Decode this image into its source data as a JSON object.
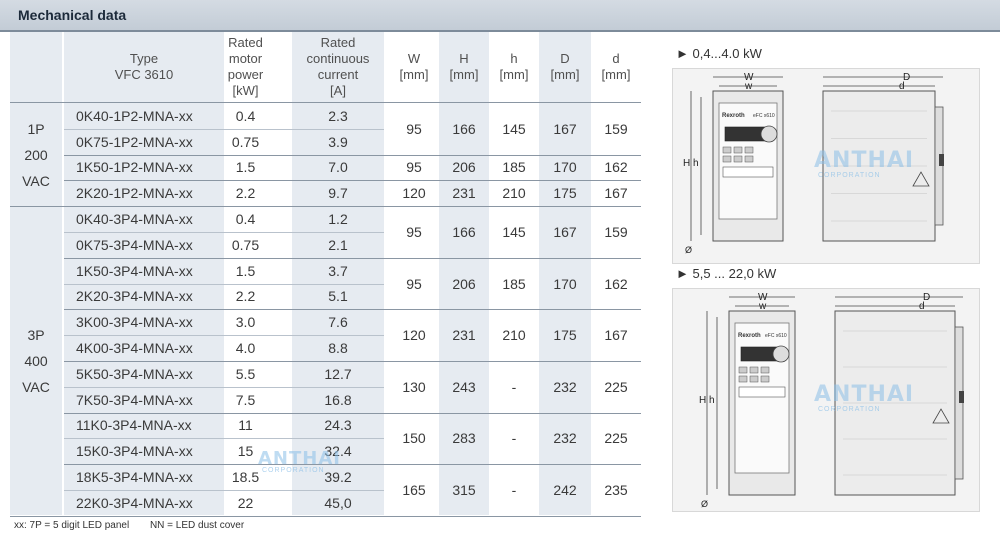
{
  "section_title": "Mechanical data",
  "headers": {
    "type": [
      "Type",
      "VFC 3610"
    ],
    "power": [
      "Rated",
      "motor",
      "power",
      "[kW]"
    ],
    "current": [
      "Rated",
      "continuous",
      "current",
      "[A]"
    ],
    "W": [
      "W",
      "[mm]"
    ],
    "H": [
      "H",
      "[mm]"
    ],
    "h": [
      "h",
      "[mm]"
    ],
    "D": [
      "D",
      "[mm]"
    ],
    "d": [
      "d",
      "[mm]"
    ]
  },
  "groups": [
    {
      "label": [
        "1P",
        "200",
        "VAC"
      ]
    },
    {
      "label": [
        "3P",
        "400",
        "VAC"
      ]
    }
  ],
  "rows": [
    {
      "type": "0K40-1P2-MNA-xx",
      "kw": "0.4",
      "a": "2.3"
    },
    {
      "type": "0K75-1P2-MNA-xx",
      "kw": "0.75",
      "a": "3.9"
    },
    {
      "type": "1K50-1P2-MNA-xx",
      "kw": "1.5",
      "a": "7.0"
    },
    {
      "type": "2K20-1P2-MNA-xx",
      "kw": "2.2",
      "a": "9.7"
    },
    {
      "type": "0K40-3P4-MNA-xx",
      "kw": "0.4",
      "a": "1.2"
    },
    {
      "type": "0K75-3P4-MNA-xx",
      "kw": "0.75",
      "a": "2.1"
    },
    {
      "type": "1K50-3P4-MNA-xx",
      "kw": "1.5",
      "a": "3.7"
    },
    {
      "type": "2K20-3P4-MNA-xx",
      "kw": "2.2",
      "a": "5.1"
    },
    {
      "type": "3K00-3P4-MNA-xx",
      "kw": "3.0",
      "a": "7.6"
    },
    {
      "type": "4K00-3P4-MNA-xx",
      "kw": "4.0",
      "a": "8.8"
    },
    {
      "type": "5K50-3P4-MNA-xx",
      "kw": "5.5",
      "a": "12.7"
    },
    {
      "type": "7K50-3P4-MNA-xx",
      "kw": "7.5",
      "a": "16.8"
    },
    {
      "type": "11K0-3P4-MNA-xx",
      "kw": "11",
      "a": "24.3"
    },
    {
      "type": "15K0-3P4-MNA-xx",
      "kw": "15",
      "a": "32.4"
    },
    {
      "type": "18K5-3P4-MNA-xx",
      "kw": "18.5",
      "a": "39.2"
    },
    {
      "type": "22K0-3P4-MNA-xx",
      "kw": "22",
      "a": "45,0"
    }
  ],
  "dims": [
    {
      "W": "95",
      "H": "166",
      "h": "145",
      "D": "167",
      "d": "159"
    },
    {
      "W": "95",
      "H": "206",
      "h": "185",
      "D": "170",
      "d": "162"
    },
    {
      "W": "120",
      "H": "231",
      "h": "210",
      "D": "175",
      "d": "167"
    },
    {
      "W": "95",
      "H": "166",
      "h": "145",
      "D": "167",
      "d": "159"
    },
    {
      "W": "95",
      "H": "206",
      "h": "185",
      "D": "170",
      "d": "162"
    },
    {
      "W": "120",
      "H": "231",
      "h": "210",
      "D": "175",
      "d": "167"
    },
    {
      "W": "130",
      "H": "243",
      "h": "-",
      "D": "232",
      "d": "225"
    },
    {
      "W": "150",
      "H": "283",
      "h": "-",
      "D": "232",
      "d": "225"
    },
    {
      "W": "165",
      "H": "315",
      "h": "-",
      "D": "242",
      "d": "235"
    }
  ],
  "drawings": [
    {
      "heading": "► 0,4...4.0 kW",
      "brand": "Rexroth",
      "model": "eFC x610",
      "labels": {
        "W": "W",
        "w": "w",
        "D": "D",
        "d": "d",
        "H": "H",
        "h": "h",
        "dia": "Ø"
      }
    },
    {
      "heading": "► 5,5 ... 22,0 kW",
      "brand": "Rexroth",
      "model": "eFC x610",
      "labels": {
        "W": "W",
        "w": "w",
        "D": "D",
        "d": "d",
        "H": "H",
        "h": "h",
        "dia": "Ø"
      }
    }
  ],
  "watermark": {
    "name": "ANTHAI",
    "sub": "CORPORATION"
  },
  "footnote": [
    "xx: 7P = 5 digit LED panel",
    "NN = LED dust cover"
  ]
}
